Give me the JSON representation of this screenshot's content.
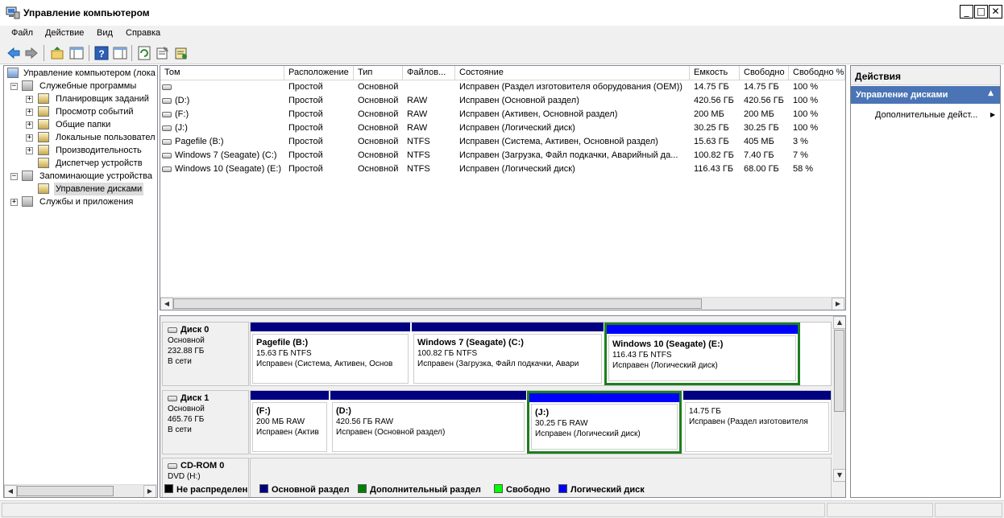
{
  "window": {
    "title": "Управление компьютером"
  },
  "menu": [
    "Файл",
    "Действие",
    "Вид",
    "Справка"
  ],
  "tree": [
    {
      "label": "Управление компьютером (лока",
      "level": 0,
      "exp": ""
    },
    {
      "label": "Служебные программы",
      "level": 1,
      "exp": "−"
    },
    {
      "label": "Планировщик заданий",
      "level": 2,
      "exp": "+"
    },
    {
      "label": "Просмотр событий",
      "level": 2,
      "exp": "+"
    },
    {
      "label": "Общие папки",
      "level": 2,
      "exp": "+"
    },
    {
      "label": "Локальные пользовател",
      "level": 2,
      "exp": "+"
    },
    {
      "label": "Производительность",
      "level": 2,
      "exp": "+"
    },
    {
      "label": "Диспетчер устройств",
      "level": 2,
      "exp": ""
    },
    {
      "label": "Запоминающие устройства",
      "level": 1,
      "exp": "−"
    },
    {
      "label": "Управление дисками",
      "level": 2,
      "exp": "",
      "selected": true
    },
    {
      "label": "Службы и приложения",
      "level": 1,
      "exp": "+"
    }
  ],
  "columns": [
    "Том",
    "Расположение",
    "Тип",
    "Файлов...",
    "Состояние",
    "Емкость",
    "Свободно",
    "Свободно %"
  ],
  "volumes": [
    [
      "",
      "Простой",
      "Основной",
      "",
      "Исправен (Раздел изготовителя оборудования (OEM))",
      "14.75 ГБ",
      "14.75 ГБ",
      "100 %"
    ],
    [
      "(D:)",
      "Простой",
      "Основной",
      "RAW",
      "Исправен (Основной раздел)",
      "420.56 ГБ",
      "420.56 ГБ",
      "100 %"
    ],
    [
      "(F:)",
      "Простой",
      "Основной",
      "RAW",
      "Исправен (Активен, Основной раздел)",
      "200 МБ",
      "200 МБ",
      "100 %"
    ],
    [
      "(J:)",
      "Простой",
      "Основной",
      "RAW",
      "Исправен (Логический диск)",
      "30.25 ГБ",
      "30.25 ГБ",
      "100 %"
    ],
    [
      "Pagefile (B:)",
      "Простой",
      "Основной",
      "NTFS",
      "Исправен (Система, Активен, Основной раздел)",
      "15.63 ГБ",
      "405 МБ",
      "3 %"
    ],
    [
      "Windows 7 (Seagate) (C:)",
      "Простой",
      "Основной",
      "NTFS",
      "Исправен (Загрузка, Файл подкачки, Аварийный да...",
      "100.82 ГБ",
      "7.40 ГБ",
      "7 %"
    ],
    [
      "Windows 10 (Seagate) (E:)",
      "Простой",
      "Основной",
      "NTFS",
      "Исправен (Логический диск)",
      "116.43 ГБ",
      "68.00 ГБ",
      "58 %"
    ]
  ],
  "disks": [
    {
      "name": "Диск 0",
      "type": "Основной",
      "size": "232.88 ГБ",
      "status": "В сети"
    },
    {
      "name": "Диск 1",
      "type": "Основной",
      "size": "465.76 ГБ",
      "status": "В сети"
    },
    {
      "name": "CD-ROM 0",
      "type": "DVD (H:)"
    }
  ],
  "disk0_parts": [
    {
      "title": "Pagefile  (B:)",
      "size": "15.63 ГБ NTFS",
      "status": "Исправен (Система, Активен, Основ",
      "bar": "#000080",
      "selected": false
    },
    {
      "title": "Windows 7 (Seagate)  (C:)",
      "size": "100.82 ГБ NTFS",
      "status": "Исправен (Загрузка, Файл подкачки, Авари",
      "bar": "#000080",
      "selected": false
    },
    {
      "title": "Windows 10 (Seagate)  (E:)",
      "size": "116.43 ГБ NTFS",
      "status": "Исправен (Логический диск)",
      "bar": "#0000ff",
      "selected": true
    }
  ],
  "disk1_parts": [
    {
      "title": "(F:)",
      "size": "200 МБ RAW",
      "status": "Исправен (Актив",
      "bar": "#000080",
      "selected": false
    },
    {
      "title": "(D:)",
      "size": "420.56 ГБ RAW",
      "status": "Исправен (Основной раздел)",
      "bar": "#000080",
      "selected": false
    },
    {
      "title": "(J:)",
      "size": "30.25 ГБ RAW",
      "status": "Исправен (Логический диск)",
      "bar": "#0000ff",
      "selected": true
    },
    {
      "title": "",
      "size": "14.75 ГБ",
      "status": "Исправен (Раздел изготовителя",
      "bar": "#000080",
      "selected": false
    }
  ],
  "legend": [
    {
      "label": "Не распределен",
      "color": "#000000"
    },
    {
      "label": "Основной раздел",
      "color": "#000080"
    },
    {
      "label": "Дополнительный раздел",
      "color": "#008000"
    },
    {
      "label": "Свободно",
      "color": "#00ff00"
    },
    {
      "label": "Логический диск",
      "color": "#0000ff"
    }
  ],
  "actions": {
    "header": "Действия",
    "section": "Управление дисками",
    "more": "Дополнительные дейст..."
  }
}
